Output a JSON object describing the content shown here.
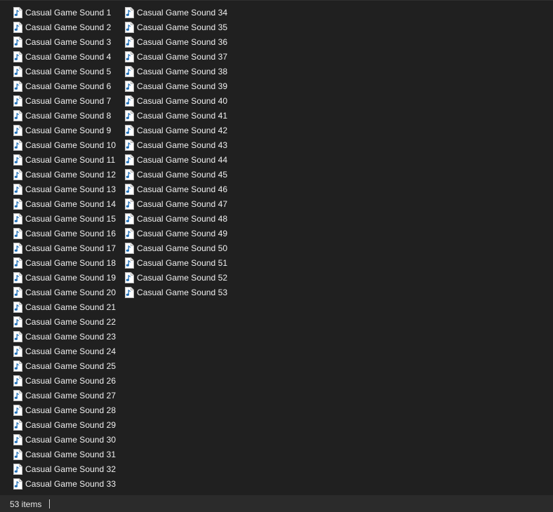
{
  "files": [
    {
      "name": "Casual Game Sound 1",
      "icon": "audio-file-icon"
    },
    {
      "name": "Casual Game Sound 2",
      "icon": "audio-file-icon"
    },
    {
      "name": "Casual Game Sound 3",
      "icon": "audio-file-icon"
    },
    {
      "name": "Casual Game Sound 4",
      "icon": "audio-file-icon"
    },
    {
      "name": "Casual Game Sound 5",
      "icon": "audio-file-icon"
    },
    {
      "name": "Casual Game Sound 6",
      "icon": "audio-file-icon"
    },
    {
      "name": "Casual Game Sound 7",
      "icon": "audio-file-icon"
    },
    {
      "name": "Casual Game Sound 8",
      "icon": "audio-file-icon"
    },
    {
      "name": "Casual Game Sound 9",
      "icon": "audio-file-icon"
    },
    {
      "name": "Casual Game Sound 10",
      "icon": "audio-file-icon"
    },
    {
      "name": "Casual Game Sound 11",
      "icon": "audio-file-icon"
    },
    {
      "name": "Casual Game Sound 12",
      "icon": "audio-file-icon"
    },
    {
      "name": "Casual Game Sound 13",
      "icon": "audio-file-icon"
    },
    {
      "name": "Casual Game Sound 14",
      "icon": "audio-file-icon"
    },
    {
      "name": "Casual Game Sound 15",
      "icon": "audio-file-icon"
    },
    {
      "name": "Casual Game Sound 16",
      "icon": "audio-file-icon"
    },
    {
      "name": "Casual Game Sound 17",
      "icon": "audio-file-icon"
    },
    {
      "name": "Casual Game Sound 18",
      "icon": "audio-file-icon"
    },
    {
      "name": "Casual Game Sound 19",
      "icon": "audio-file-icon"
    },
    {
      "name": "Casual Game Sound 20",
      "icon": "audio-file-icon"
    },
    {
      "name": "Casual Game Sound 21",
      "icon": "audio-file-icon"
    },
    {
      "name": "Casual Game Sound 22",
      "icon": "audio-file-icon"
    },
    {
      "name": "Casual Game Sound 23",
      "icon": "audio-file-icon"
    },
    {
      "name": "Casual Game Sound 24",
      "icon": "audio-file-icon"
    },
    {
      "name": "Casual Game Sound 25",
      "icon": "audio-file-icon"
    },
    {
      "name": "Casual Game Sound 26",
      "icon": "audio-file-icon"
    },
    {
      "name": "Casual Game Sound 27",
      "icon": "audio-file-icon"
    },
    {
      "name": "Casual Game Sound 28",
      "icon": "audio-file-icon"
    },
    {
      "name": "Casual Game Sound 29",
      "icon": "audio-file-icon"
    },
    {
      "name": "Casual Game Sound 30",
      "icon": "audio-file-icon"
    },
    {
      "name": "Casual Game Sound 31",
      "icon": "audio-file-icon"
    },
    {
      "name": "Casual Game Sound 32",
      "icon": "audio-file-icon"
    },
    {
      "name": "Casual Game Sound 33",
      "icon": "audio-file-icon"
    },
    {
      "name": "Casual Game Sound 34",
      "icon": "audio-file-icon"
    },
    {
      "name": "Casual Game Sound 35",
      "icon": "audio-file-icon"
    },
    {
      "name": "Casual Game Sound 36",
      "icon": "audio-file-icon"
    },
    {
      "name": "Casual Game Sound 37",
      "icon": "audio-file-icon"
    },
    {
      "name": "Casual Game Sound 38",
      "icon": "audio-file-icon"
    },
    {
      "name": "Casual Game Sound 39",
      "icon": "audio-file-icon"
    },
    {
      "name": "Casual Game Sound 40",
      "icon": "audio-file-icon"
    },
    {
      "name": "Casual Game Sound 41",
      "icon": "audio-file-icon"
    },
    {
      "name": "Casual Game Sound 42",
      "icon": "audio-file-icon"
    },
    {
      "name": "Casual Game Sound 43",
      "icon": "audio-file-icon"
    },
    {
      "name": "Casual Game Sound 44",
      "icon": "audio-file-icon"
    },
    {
      "name": "Casual Game Sound 45",
      "icon": "audio-file-icon"
    },
    {
      "name": "Casual Game Sound 46",
      "icon": "audio-file-icon"
    },
    {
      "name": "Casual Game Sound 47",
      "icon": "audio-file-icon"
    },
    {
      "name": "Casual Game Sound 48",
      "icon": "audio-file-icon"
    },
    {
      "name": "Casual Game Sound 49",
      "icon": "audio-file-icon"
    },
    {
      "name": "Casual Game Sound 50",
      "icon": "audio-file-icon"
    },
    {
      "name": "Casual Game Sound 51",
      "icon": "audio-file-icon"
    },
    {
      "name": "Casual Game Sound 52",
      "icon": "audio-file-icon"
    },
    {
      "name": "Casual Game Sound 53",
      "icon": "audio-file-icon"
    }
  ],
  "status_bar": {
    "item_count": "53 items"
  },
  "colors": {
    "background": "#202020",
    "status_bar": "#2b2b2b",
    "text": "#f0f0f0",
    "icon_accent": "#1e6fb8"
  }
}
